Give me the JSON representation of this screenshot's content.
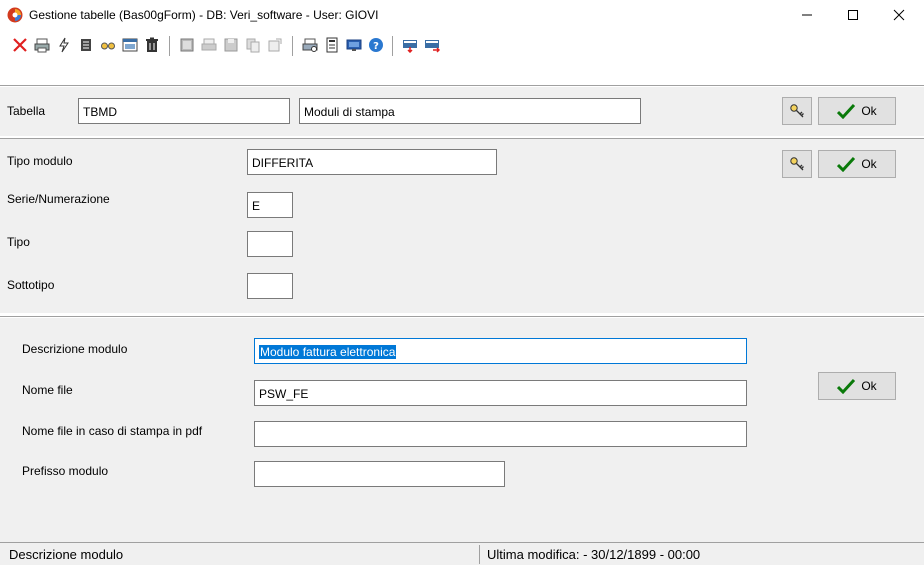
{
  "window": {
    "title": "Gestione tabelle  (Bas00gForm) - DB: Veri_software - User: GIOVI",
    "minimize_glyph": "—",
    "maximize_glyph": "☐",
    "close_glyph": "✕"
  },
  "toolbar": {
    "icons": [
      "close-x-icon",
      "printer-icon",
      "lightning-icon",
      "list-icon",
      "glasses-icon",
      "window-icon",
      "trash-icon",
      "book-icon",
      "printer-grey-icon",
      "floppy-icon",
      "copy-icon",
      "export-icon",
      "print-preview-icon",
      "document-icon",
      "monitor-icon",
      "help-icon",
      "import-icon",
      "export-red-icon"
    ]
  },
  "header": {
    "tabella_label": "Tabella",
    "tabella_code": "TBMD",
    "tabella_desc": "Moduli di stampa",
    "ok_label": "Ok"
  },
  "section_mid": {
    "tipo_modulo_label": "Tipo modulo",
    "tipo_modulo_value": "DIFFERITA",
    "serie_label": "Serie/Numerazione",
    "serie_value": "E",
    "tipo_label": "Tipo",
    "tipo_value": "",
    "sottotipo_label": "Sottotipo",
    "sottotipo_value": "",
    "ok_label": "Ok"
  },
  "section_low": {
    "descrizione_label": "Descrizione modulo",
    "descrizione_value": "Modulo fattura elettronica",
    "nome_file_label": "Nome file",
    "nome_file_value": "PSW_FE",
    "nome_file_pdf_label": "Nome file in caso di stampa in pdf",
    "nome_file_pdf_value": "",
    "prefisso_label": "Prefisso modulo",
    "prefisso_value": "",
    "ok_label": "Ok"
  },
  "statusbar": {
    "left": "Descrizione modulo",
    "right": "Ultima modifica:  - 30/12/1899 - 00:00"
  },
  "colors": {
    "accent": "#0078d7",
    "panel": "#f0f0f0",
    "ok_check": "#0a7a0a",
    "close_x": "#e02020"
  }
}
